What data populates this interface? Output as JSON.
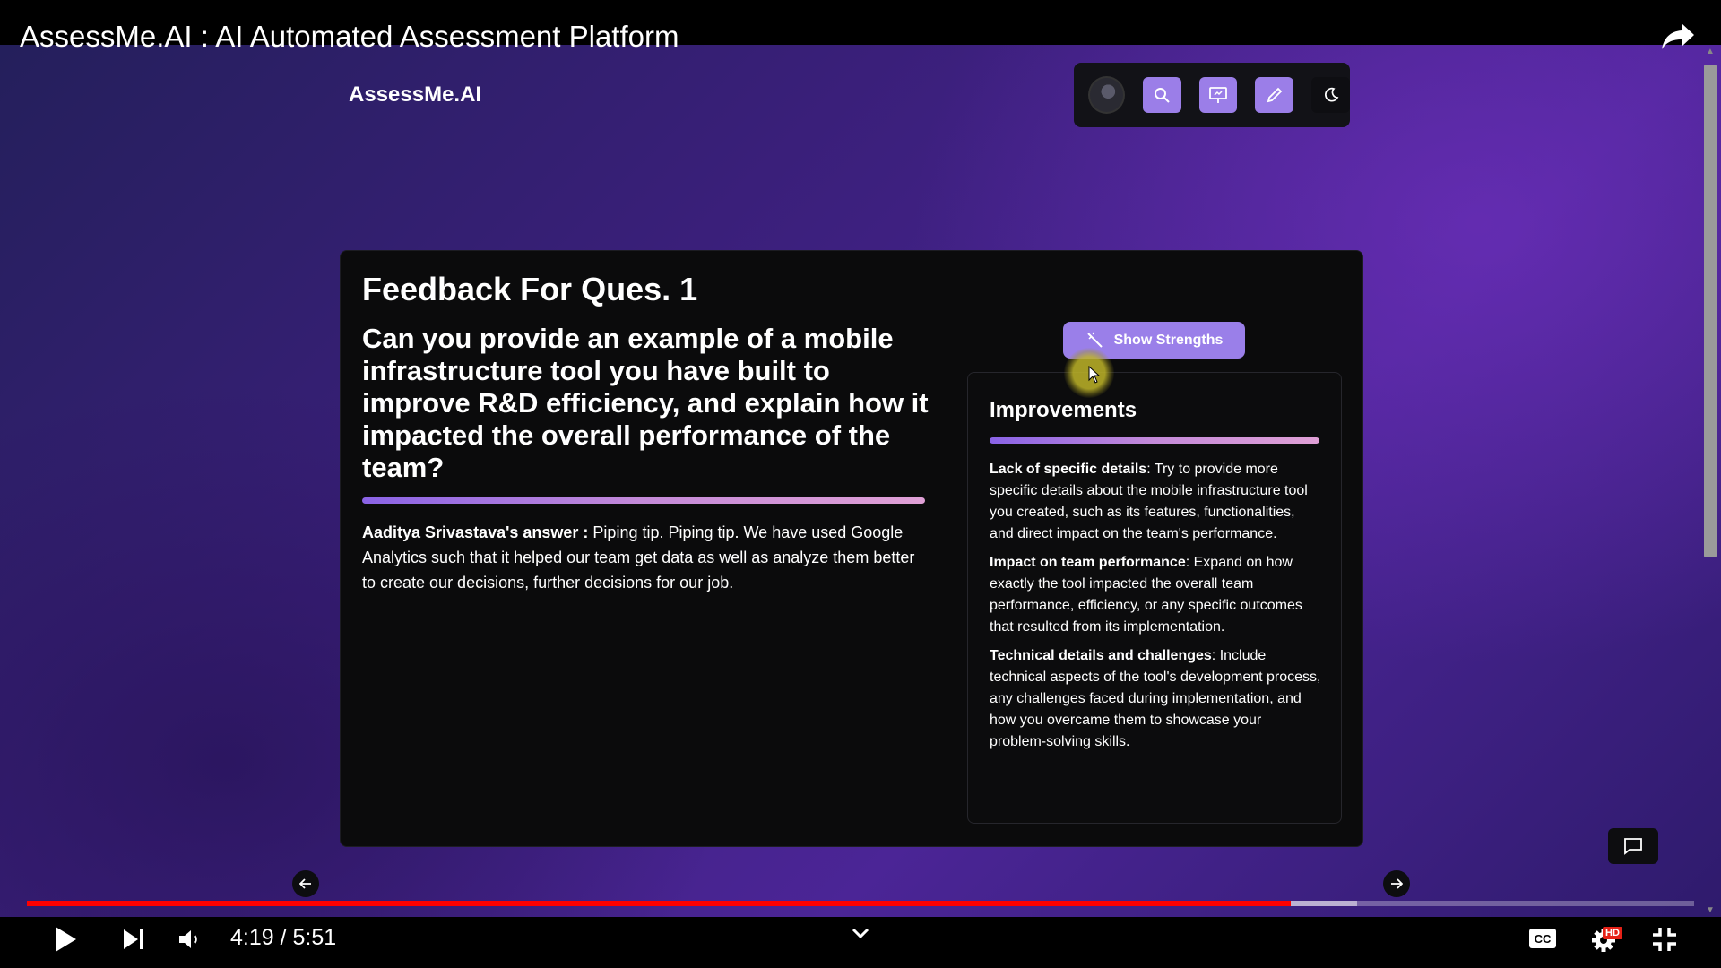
{
  "video": {
    "title": "AssessMe.AI : AI Automated Assessment Platform",
    "time_display": "4:19 / 5:51",
    "progress_played": 0.7578,
    "progress_buffered": 0.7978,
    "hd_label": "HD"
  },
  "app": {
    "brand": "AssessMe.AI",
    "toolbar": {
      "icons": [
        "avatar",
        "search-icon",
        "presentation-icon",
        "pencil-icon",
        "moon-icon"
      ]
    }
  },
  "feedback": {
    "heading": "Feedback For Ques. 1",
    "question": "Can you provide an example of a mobile infrastructure tool you have built to improve R&D efficiency, and explain how it impacted the overall performance of the team?",
    "answer_label": "Aaditya Srivastava's answer :",
    "answer_text": " Piping tip. Piping tip. We have used Google Analytics such that it helped our team get data as well as analyze them better to create our decisions, further decisions for our job.",
    "strengths_button": "Show Strengths",
    "improvements_title": "Improvements",
    "improvements": [
      {
        "label": "Lack of specific details",
        "text": ": Try to provide more specific details about the mobile infrastructure tool you created, such as its features, functionalities, and direct impact on the team's performance."
      },
      {
        "label": "Impact on team performance",
        "text": ": Expand on how exactly the tool impacted the overall team performance, efficiency, or any specific outcomes that resulted from its implementation."
      },
      {
        "label": "Technical details and challenges",
        "text": ": Include technical aspects of the tool's development process, any challenges faced during implementation, and how you overcame them to showcase your problem-solving skills."
      }
    ]
  },
  "colors": {
    "accent": "#9a7fe9",
    "progress": "#ff0000",
    "card_bg": "#0b0b0c"
  }
}
